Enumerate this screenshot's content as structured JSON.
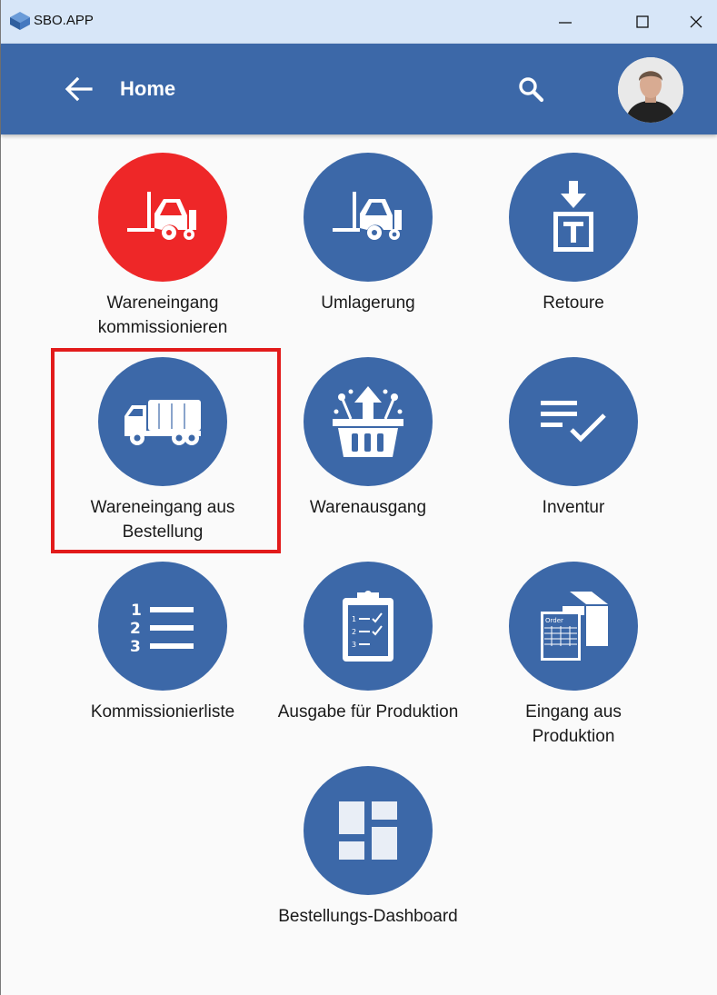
{
  "window": {
    "title": "SBO.APP",
    "controls": [
      "minimize",
      "maximize",
      "close"
    ]
  },
  "appbar": {
    "title": "Home",
    "back_icon": "arrow-left-icon",
    "search_icon": "search-icon",
    "avatar": "user-avatar"
  },
  "tiles": [
    {
      "label": "Wareneingang kommissionieren",
      "icon": "forklift-icon",
      "color": "#ee2728"
    },
    {
      "label": "Umlagerung",
      "icon": "forklift-icon",
      "color": "#3c68a8"
    },
    {
      "label": "Retoure",
      "icon": "return-box-icon",
      "color": "#3c68a8"
    },
    {
      "label": "Wareneingang aus Bestellung",
      "icon": "truck-icon",
      "color": "#3c68a8"
    },
    {
      "label": "Warenausgang",
      "icon": "basket-upload-icon",
      "color": "#3c68a8"
    },
    {
      "label": "Inventur",
      "icon": "checklist-icon",
      "color": "#3c68a8"
    },
    {
      "label": "Kommissionierliste",
      "icon": "numbered-list-icon",
      "color": "#3c68a8"
    },
    {
      "label": "Ausgabe für Produktion",
      "icon": "clipboard-icon",
      "color": "#3c68a8"
    },
    {
      "label": "Eingang aus Produktion",
      "icon": "order-box-icon",
      "color": "#3c68a8"
    },
    {
      "label": "Bestellungs-Dashboard",
      "icon": "dashboard-icon",
      "color": "#3c68a8"
    }
  ],
  "colors": {
    "primary": "#3c68a8",
    "accent_red": "#ee2728",
    "titlebar": "#d7e6f8",
    "highlight": "#e21b1b"
  }
}
